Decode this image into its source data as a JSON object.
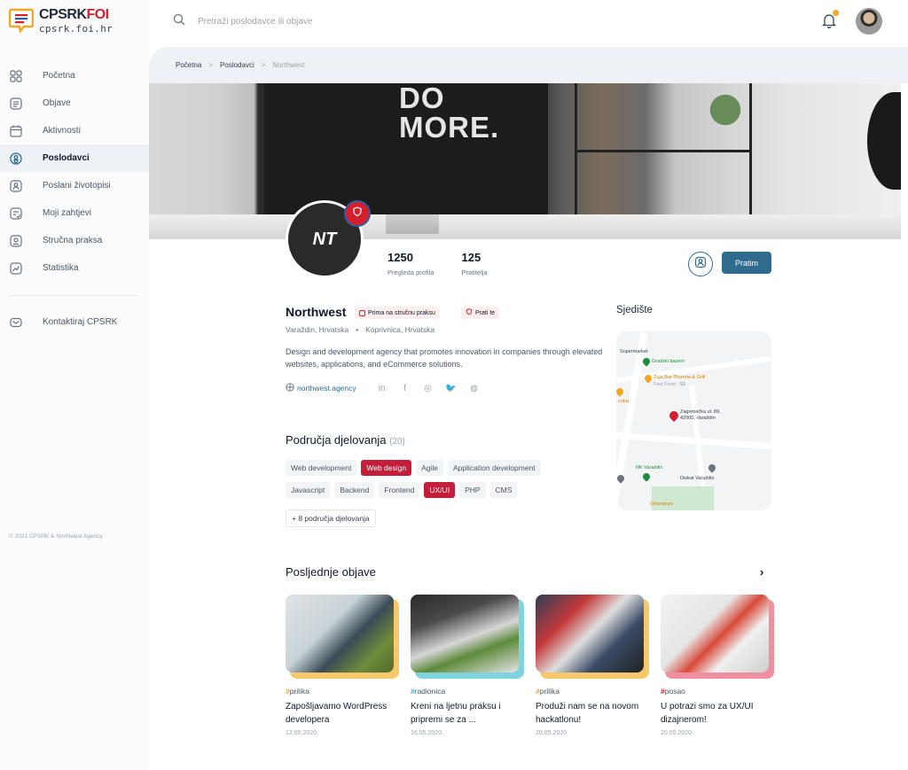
{
  "brand": {
    "title_main": "CPSRK",
    "title_accent": "FOI",
    "subtitle": "cpsrk.foi.hr"
  },
  "search": {
    "placeholder": "Pretraži poslodavce ili objave"
  },
  "sidebar": {
    "items": [
      {
        "label": "Početna",
        "icon": "grid-icon"
      },
      {
        "label": "Objave",
        "icon": "news-icon"
      },
      {
        "label": "Aktivnosti",
        "icon": "calendar-icon"
      },
      {
        "label": "Poslodavci",
        "icon": "employer-icon",
        "active": true
      },
      {
        "label": "Poslani životopisi",
        "icon": "cv-icon"
      },
      {
        "label": "Moji zahtjevi",
        "icon": "requests-icon"
      },
      {
        "label": "Stručna praksa",
        "icon": "internship-icon"
      },
      {
        "label": "Statistika",
        "icon": "chart-icon"
      }
    ],
    "contact": {
      "label": "Kontaktiraj CPSRK",
      "icon": "mail-icon"
    },
    "copyright": "© 2021 CPSRK & Northwest Agency"
  },
  "breadcrumb": {
    "items": [
      "Početna",
      "Poslodavci"
    ],
    "current": "Northwest",
    "separator": ">"
  },
  "cover": {
    "screen_line1": "DO",
    "screen_line2": "MORE."
  },
  "company": {
    "name": "Northwest",
    "logo_text": "NT",
    "chips": [
      "Prima na stručnu praksu",
      "Prati te"
    ],
    "locations": [
      "Varaždin, Hrvatska",
      "Koprivnica, Hrvatska"
    ],
    "location_separator": "•",
    "description": "Design and development agency that promotes innovation in companies through elevated websites, applications, and eCommerce solutions.",
    "website": "northwest.agency",
    "socials": [
      "in",
      "f",
      "◎",
      "🐦",
      "◍"
    ]
  },
  "stats": [
    {
      "value": "1250",
      "label": "Pregleda profila"
    },
    {
      "value": "125",
      "label": "Pratitelja"
    }
  ],
  "actions": {
    "follow_label": "Pratim"
  },
  "headquarters": {
    "title": "Sjedište",
    "map_labels": {
      "supermarket": "Supermarket",
      "park": "Gradski bazeni",
      "restaurant": "Žuja Bar Pizzeria & Grill",
      "restaurant_sub": "Fast Food · $$",
      "club": "cuba",
      "address": "Zagrebačka ul. 89, 42000, Varaždin",
      "nk": "NK Varaždin",
      "diokat": "Diokat Varaždin",
      "bottom": "Ozonatura"
    }
  },
  "areas": {
    "title": "Područja djelovanja",
    "count": "(20)",
    "rows": [
      [
        {
          "label": "Web development",
          "highlight": false
        },
        {
          "label": "Web design",
          "highlight": true
        },
        {
          "label": "Agile",
          "highlight": false
        },
        {
          "label": "Application development",
          "highlight": false
        }
      ],
      [
        {
          "label": "Javascript",
          "highlight": false
        },
        {
          "label": "Backend",
          "highlight": false
        },
        {
          "label": "Frontend",
          "highlight": false
        },
        {
          "label": "UX/UI",
          "highlight": true
        },
        {
          "label": "PHP",
          "highlight": false
        },
        {
          "label": "CMS",
          "highlight": false
        }
      ]
    ],
    "more_label": "+ 8 područja djelovanja"
  },
  "posts": {
    "title": "Posljednje objave",
    "items": [
      {
        "category": "prilika",
        "hash_color": "#f5a623",
        "accent": "#f7c76b",
        "title": "Zapošljavamo WordPress developera",
        "date": "12.05.2020."
      },
      {
        "category": "radionica",
        "hash_color": "#3bb6c9",
        "accent": "#7fd3df",
        "title": "Kreni na ljetnu praksu i pripremi se za ...",
        "date": "16.05.2020."
      },
      {
        "category": "prilika",
        "hash_color": "#f5a623",
        "accent": "#f7c76b",
        "title": "Produži nam se na novom hackatlonu!",
        "date": "20.05.2020."
      },
      {
        "category": "posao",
        "hash_color": "#d2202f",
        "accent": "#f08fa0",
        "title": "U potrazi smo za UX/UI dizajnerom!",
        "date": "20.05.2020."
      }
    ]
  },
  "colors": {
    "brand_red": "#d2202f",
    "primary_blue": "#2f6b8f",
    "notification": "#f5a623"
  }
}
